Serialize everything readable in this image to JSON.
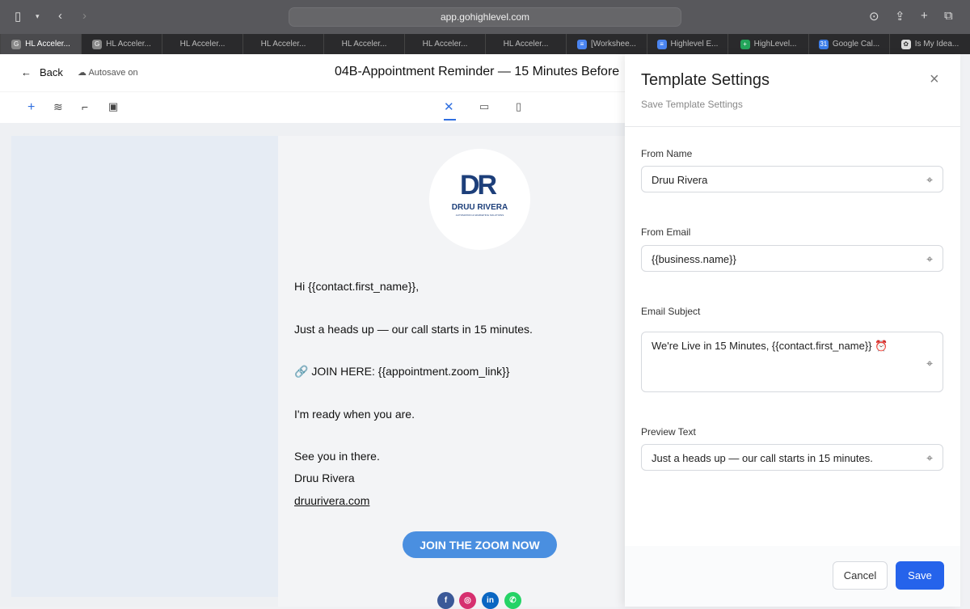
{
  "browser": {
    "url": "app.gohighlevel.com",
    "tabs": [
      "HL Acceler...",
      "HL Acceler...",
      "HL Acceler...",
      "HL Acceler...",
      "HL Acceler...",
      "HL Acceler...",
      "HL Acceler...",
      "[Workshee...",
      "Highlevel E...",
      "HighLevel...",
      "Google Cal...",
      "Is My Idea..."
    ]
  },
  "header": {
    "back": "Back",
    "autosave": "Autosave on",
    "title": "04B-Appointment Reminder — 15 Minutes Before"
  },
  "email": {
    "logo_name": "DRUU RIVERA",
    "logo_tagline": "AUTOMATION & MARKETING SOLUTIONS",
    "lines": [
      "Hi {{contact.first_name}},",
      "Just a heads up — our call starts in 15 minutes.",
      "🔗 JOIN HERE: {{appointment.zoom_link}}",
      "I'm ready when you are.",
      "See you in there.",
      "Druu Rivera",
      "druurivera.com"
    ],
    "cta": "JOIN THE ZOOM NOW",
    "accent": "#4a8fe0"
  },
  "panel": {
    "title": "Template Settings",
    "subtitle": "Save Template Settings",
    "fields": [
      {
        "label": "From Name",
        "value": "Druu Rivera"
      },
      {
        "label": "From Email",
        "value": "{{business.name}}"
      },
      {
        "label": "Email Subject",
        "value": "We're Live in 15 Minutes, {{contact.first_name}} ⏰"
      },
      {
        "label": "Preview Text",
        "value": "Just a heads up — our call starts in 15 minutes."
      }
    ],
    "cancel": "Cancel",
    "save": "Save"
  }
}
